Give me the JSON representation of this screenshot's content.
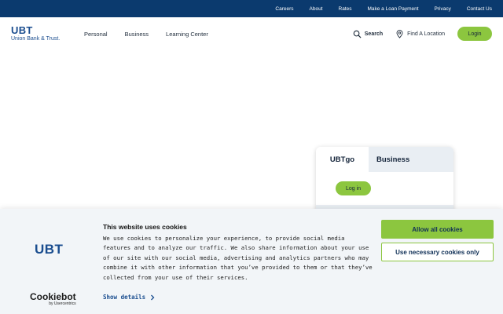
{
  "topbar": {
    "links": [
      "Careers",
      "About",
      "Rates",
      "Make a Loan Payment",
      "Privacy",
      "Contact Us"
    ]
  },
  "header": {
    "logo_mark": "UBT",
    "logo_sub": "Union Bank & Trust.",
    "nav": [
      "Personal",
      "Business",
      "Learning Center"
    ],
    "search_label": "Search",
    "location_label": "Find A Location",
    "login_label": "Login"
  },
  "login_card": {
    "tabs": [
      "UBTgo",
      "Business"
    ],
    "login_button": "Log in"
  },
  "consent": {
    "logo": "UBT",
    "cookiebot": "Cookiebot",
    "cookiebot_by": "by Usercentrics",
    "title": "This website uses cookies",
    "body": "We use cookies to personalize your experience, to provide social media features and to analyze our traffic. We also share information about your use of our site with our social media, advertising and analytics partners who may combine it with other information that you’ve provided to them or that they’ve collected from your use of their services.",
    "details_label": "Show details",
    "allow_all": "Allow all cookies",
    "necessary_only": "Use necessary cookies only"
  },
  "colors": {
    "brand_blue": "#0b3a6e",
    "accent_green": "#8cc63f"
  }
}
